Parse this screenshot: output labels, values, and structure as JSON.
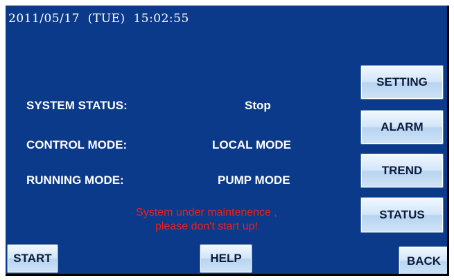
{
  "header": {
    "datetime": "2011/05/17  (TUE)  15:02:55"
  },
  "status_panel": {
    "system_status_label": "SYSTEM STATUS:",
    "system_status_value": "Stop",
    "control_mode_label": "CONTROL MODE:",
    "control_mode_value": "LOCAL MODE",
    "running_mode_label": "RUNNING MODE:",
    "running_mode_value": "PUMP MODE"
  },
  "warning": {
    "line1": "System under maintenence ,",
    "line2": "please don't start up!"
  },
  "side_menu": {
    "setting": "SETTING",
    "alarm": "ALARM",
    "trend": "TREND",
    "status": "STATUS"
  },
  "bottom_bar": {
    "start": "START",
    "help": "HELP",
    "back": "BACK"
  },
  "colors": {
    "screen_background": "#0c3a8a",
    "text": "#ffffff",
    "warning_text": "#e32222",
    "button_face": "#d2e6f8",
    "button_text": "#0d1b3d"
  }
}
